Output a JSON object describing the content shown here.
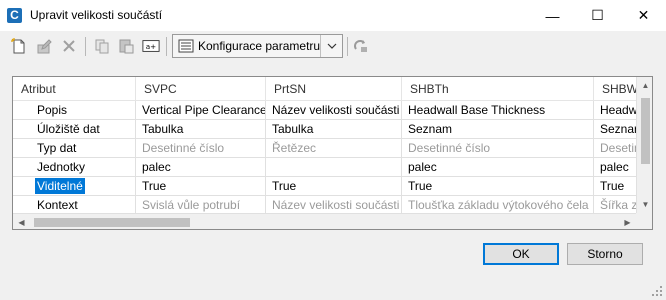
{
  "window": {
    "title": "Upravit velikosti součástí",
    "app_icon_letter": "C",
    "minimize_symbol": "—",
    "maximize_symbol": "☐",
    "close_symbol": "✕"
  },
  "toolbar": {
    "icons": [
      "new-row-icon",
      "edit-icon",
      "delete-icon",
      "copy-icon",
      "paste-icon",
      "rename-icon",
      "config-icon",
      "refresh-icon"
    ],
    "config_label": "Konfigurace parametru"
  },
  "grid": {
    "columns": [
      "Atribut",
      "SVPC",
      "PrtSN",
      "SHBTh",
      "SHBW"
    ],
    "rows": [
      {
        "label": "Popis",
        "values": [
          "Vertical Pipe Clearance",
          "Název velikosti součásti",
          "Headwall Base Thickness",
          "Headw"
        ],
        "disabled": [
          false,
          false,
          false,
          false
        ],
        "selected": false
      },
      {
        "label": "Úložiště dat",
        "values": [
          "Tabulka",
          "Tabulka",
          "Seznam",
          "Seznar"
        ],
        "disabled": [
          false,
          false,
          false,
          false
        ],
        "selected": false
      },
      {
        "label": "Typ dat",
        "values": [
          "Desetinné číslo",
          "Řetězec",
          "Desetinné číslo",
          "Desetin"
        ],
        "disabled": [
          true,
          true,
          true,
          true
        ],
        "selected": false
      },
      {
        "label": "Jednotky",
        "values": [
          "palec",
          "",
          "palec",
          "palec"
        ],
        "disabled": [
          false,
          false,
          false,
          false
        ],
        "selected": false
      },
      {
        "label": "Viditelné",
        "values": [
          "True",
          "True",
          "True",
          "True"
        ],
        "disabled": [
          false,
          false,
          false,
          false
        ],
        "selected": true
      },
      {
        "label": "Kontext",
        "values": [
          "Svislá vůle potrubí",
          "Název velikosti součásti",
          "Tloušťka základu výtokového čela",
          "Šířka z"
        ],
        "disabled": [
          true,
          true,
          true,
          true
        ],
        "selected": false
      }
    ]
  },
  "buttons": {
    "ok": "OK",
    "cancel": "Storno"
  },
  "colors": {
    "selection": "#0078d7",
    "disabled_text": "#9a9a9a",
    "app_icon": "#1c6fb7"
  }
}
